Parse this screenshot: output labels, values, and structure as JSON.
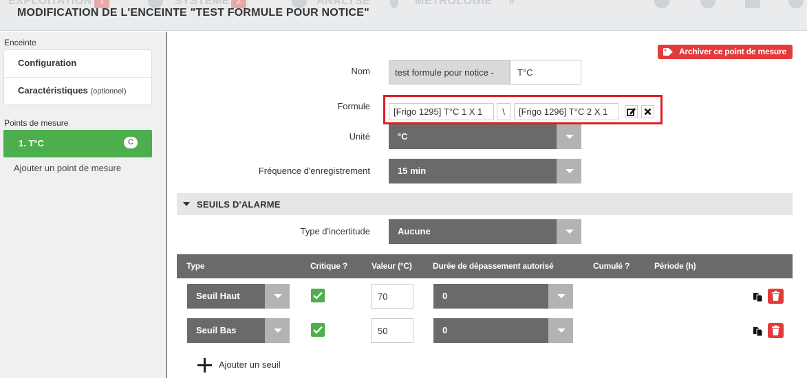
{
  "header": {
    "title": "MODIFICATION DE L'ENCEINTE \"TEST FORMULE POUR NOTICE\"",
    "nav_ghost": [
      "EXPLOITATION",
      "SYSTÈME",
      "ANALYSE",
      "MÉTROLOGIE"
    ],
    "nav_badges": [
      "1",
      "2"
    ]
  },
  "sidebar": {
    "section_enceinte": "Enceinte",
    "links": [
      {
        "label": "Configuration",
        "note": ""
      },
      {
        "label": "Caractéristiques",
        "note": "(optionnel)"
      }
    ],
    "section_points": "Points de mesure",
    "active_point": "1. T°C",
    "active_badge": "C",
    "add_point": "Ajouter un point de mesure"
  },
  "main": {
    "archive_button": "Archiver ce point de mesure",
    "nom": {
      "label": "Nom",
      "prefix": "test formule pour notice -",
      "value": "T°C"
    },
    "formule": {
      "label": "Formule",
      "operand1": "[Frigo 1295] T°C 1 X 1",
      "operator": "\\",
      "operand2": "[Frigo 1296] T°C 2 X 1"
    },
    "unite": {
      "label": "Unité",
      "value": "°C"
    },
    "frequence": {
      "label": "Fréquence d'enregistrement",
      "value": "15 min"
    },
    "seuils_section": "SEUILS D'ALARME",
    "incertitude": {
      "label": "Type d'incertitude",
      "value": "Aucune"
    },
    "table": {
      "headers": [
        "Type",
        "Critique ?",
        "Valeur (°C)",
        "Durée de dépassement autorisé",
        "Cumulé ?",
        "Période (h)"
      ],
      "rows": [
        {
          "type": "Seuil Haut",
          "critique": true,
          "valeur": "70",
          "duree": "0"
        },
        {
          "type": "Seuil Bas",
          "critique": true,
          "valeur": "50",
          "duree": "0"
        }
      ]
    },
    "add_seuil": "Ajouter un seuil"
  },
  "colors": {
    "accent_green": "#4cae4c",
    "danger_red": "#e33b3b",
    "highlight_frame": "#e01b24",
    "select_dark": "#6a6a6a"
  }
}
